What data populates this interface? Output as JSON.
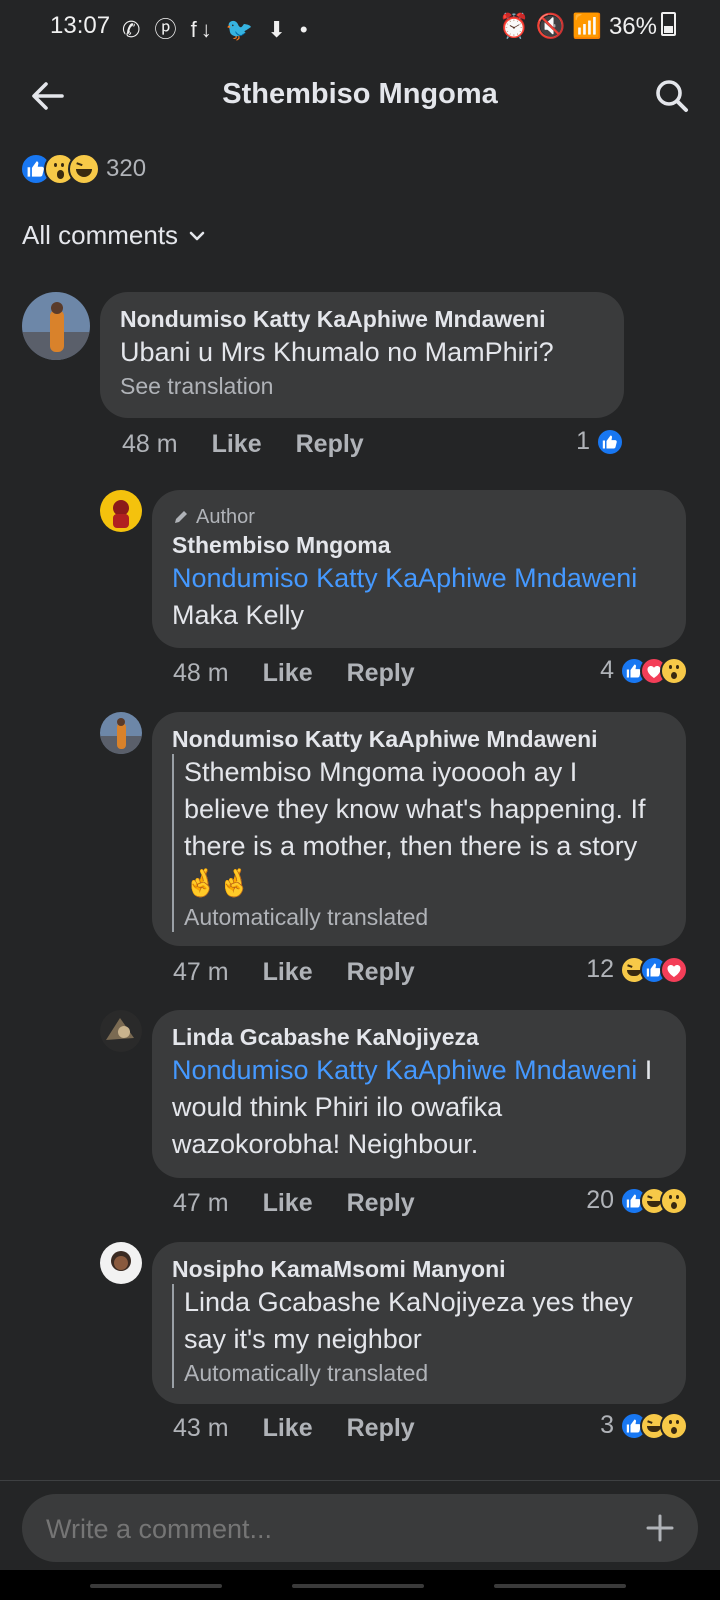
{
  "status_bar": {
    "time": "13:07",
    "left_icons": "✆ ⓟ f↓ 🐦 ⬇ •",
    "battery": "36%"
  },
  "header": {
    "title": "Sthembiso Mngoma"
  },
  "reactions_summary": {
    "count": "320",
    "icons": [
      "like-icon",
      "wow-icon",
      "haha-icon"
    ]
  },
  "filter": {
    "label": "All comments"
  },
  "comments": [
    {
      "name": "Nondumiso Katty KaAphiwe Mndaweni",
      "text": "Ubani u Mrs Khumalo no MamPhiri?",
      "sub": "See translation",
      "time": "48 m",
      "like_label": "Like",
      "reply_label": "Reply",
      "reaction_count": "1"
    },
    {
      "author_label": "Author",
      "name": "Sthembiso Mngoma",
      "mention": "Nondumiso Katty KaAphiwe Mndaweni",
      "text": " Maka Kelly",
      "time": "48 m",
      "like_label": "Like",
      "reply_label": "Reply",
      "reaction_count": "4"
    },
    {
      "name": "Nondumiso Katty KaAphiwe Mndaweni",
      "text": "Sthembiso Mngoma iyooooh ay I believe they know what's happening. If there is a mother, then there is a story 🤞🤞",
      "sub": "Automatically translated",
      "time": "47 m",
      "like_label": "Like",
      "reply_label": "Reply",
      "reaction_count": "12"
    },
    {
      "name": "Linda Gcabashe KaNojiyeza",
      "mention": "Nondumiso Katty KaAphiwe Mndaweni",
      "text": " I would think Phiri ilo owafika wazokorobha! Neighbour.",
      "time": "47 m",
      "like_label": "Like",
      "reply_label": "Reply",
      "reaction_count": "20"
    },
    {
      "name": "Nosipho KamaMsomi Manyoni",
      "text": "Linda Gcabashe KaNojiyeza yes they say it's my neighbor",
      "sub": "Automatically translated",
      "time": "43 m",
      "like_label": "Like",
      "reply_label": "Reply",
      "reaction_count": "3"
    }
  ],
  "composer": {
    "placeholder": "Write a comment..."
  },
  "colors": {
    "background": "#242526",
    "bubble": "#3a3b3c",
    "link": "#4599ff",
    "like": "#1877f2",
    "love": "#f33e58",
    "emoji": "#f7c948"
  }
}
